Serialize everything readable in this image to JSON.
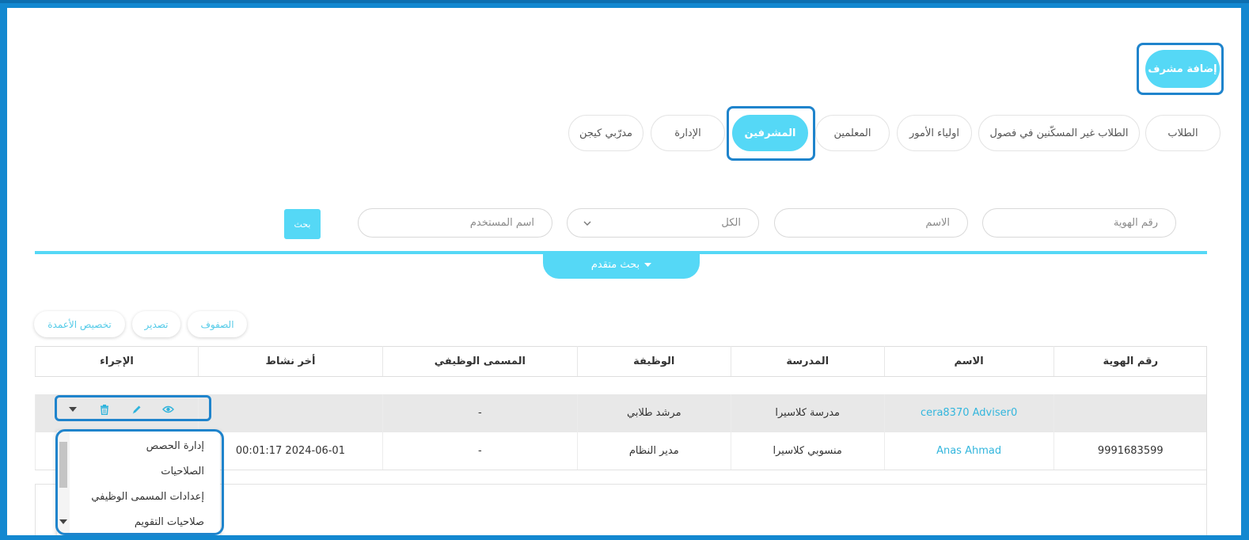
{
  "header": {
    "add_supervisor_label": "إضافة مشرف"
  },
  "tabs": [
    {
      "label": "الطلاب"
    },
    {
      "label": "الطلاب غير المسكّنين في فصول"
    },
    {
      "label": "اولياء الأمور"
    },
    {
      "label": "المعلمين"
    },
    {
      "label": "المشرفين"
    },
    {
      "label": "الإدارة"
    },
    {
      "label": "مدرّبي كيجن"
    }
  ],
  "active_tab": "المشرفين",
  "filters": {
    "id_placeholder": "رقم الهوية",
    "name_placeholder": "الاسم",
    "all_option": "الكل",
    "username_placeholder": "اسم المستخدم",
    "search_label": "بحث",
    "advanced_search_label": "بحث متقدم"
  },
  "toolbar": {
    "rows_label": "الصفوف",
    "export_label": "تصدير",
    "customize_columns_label": "تخصيص الأعمدة"
  },
  "table": {
    "headers": [
      "رقم الهوية",
      "الاسم",
      "المدرسة",
      "الوظيفة",
      "المسمى الوظيفي",
      "أخر نشاط",
      "الإجراء"
    ],
    "rows": [
      {
        "id": "",
        "name": "cera8370 Adviser0",
        "school": "مدرسة كلاسيرا",
        "job": "مرشد طلابي",
        "title": "-",
        "last_activity": ""
      },
      {
        "id": "9991683599",
        "name": "Anas Ahmad",
        "school": "منسوبي كلاسيرا",
        "job": "مدير النظام",
        "title": "-",
        "last_activity": "2024-06-01 00:01:17"
      }
    ]
  },
  "action_menu": {
    "items": [
      "إدارة الحصص",
      "الصلاحيات",
      "إعدادات المسمى الوظيفي",
      "صلاحيات التقويم"
    ]
  },
  "colors": {
    "accent": "#55d8f6",
    "highlight": "#1f84cc",
    "link": "#33b6dd"
  }
}
